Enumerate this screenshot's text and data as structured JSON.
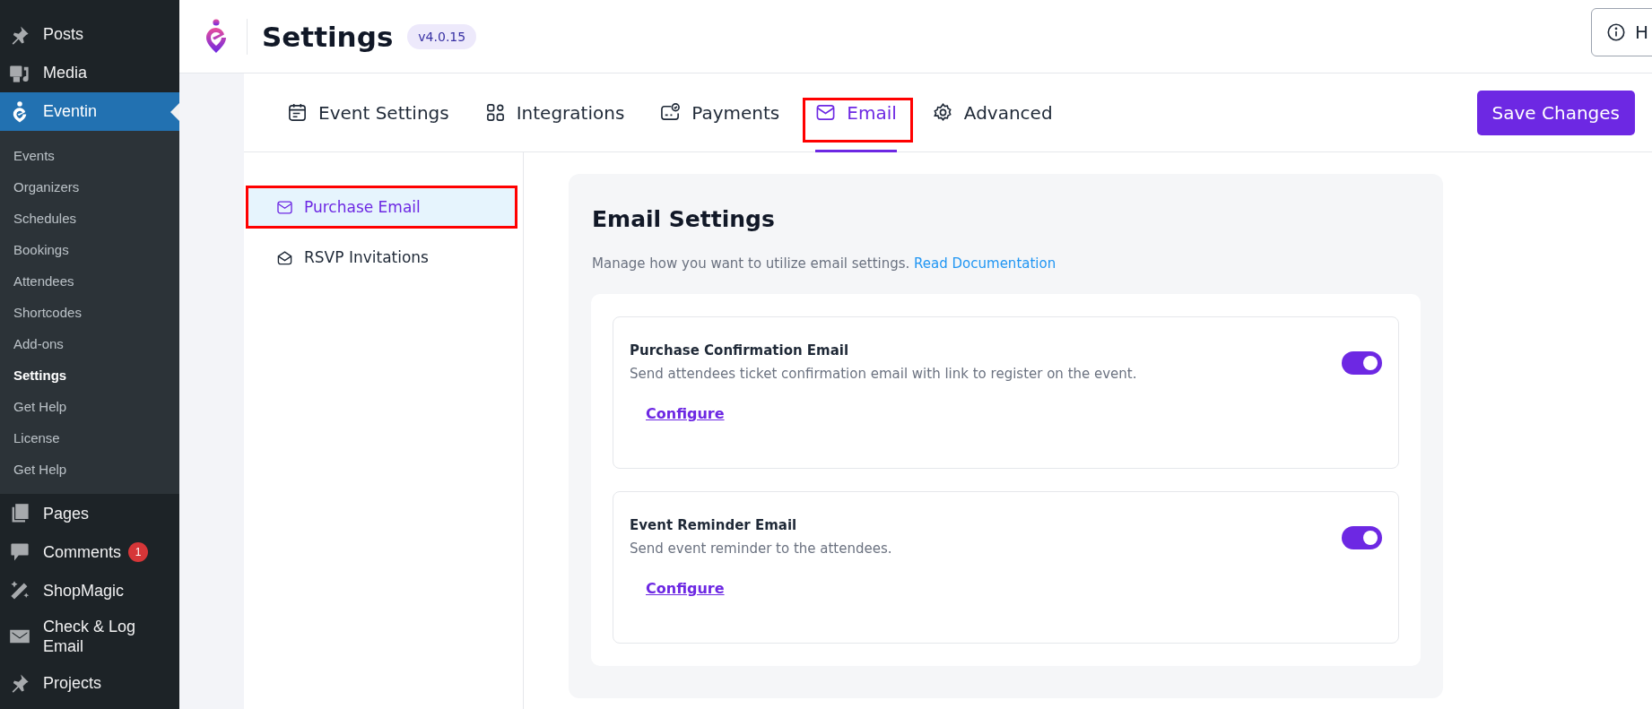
{
  "admin_menu": {
    "top": [
      {
        "label": "Posts",
        "kind": "pin",
        "current": false
      },
      {
        "label": "Media",
        "kind": "media",
        "current": false
      },
      {
        "label": "Eventin",
        "kind": "eventin",
        "current": true
      }
    ],
    "submenu": [
      {
        "label": "Events",
        "selected": false
      },
      {
        "label": "Organizers",
        "selected": false
      },
      {
        "label": "Schedules",
        "selected": false
      },
      {
        "label": "Bookings",
        "selected": false
      },
      {
        "label": "Attendees",
        "selected": false
      },
      {
        "label": "Shortcodes",
        "selected": false
      },
      {
        "label": "Add-ons",
        "selected": false
      },
      {
        "label": "Settings",
        "selected": true
      },
      {
        "label": "Get Help",
        "selected": false
      },
      {
        "label": "License",
        "selected": false
      },
      {
        "label": "Get Help",
        "selected": false
      }
    ],
    "bottom": [
      {
        "label": "Pages",
        "kind": "pages",
        "current": false
      },
      {
        "label": "Comments",
        "kind": "comment",
        "current": false,
        "badge": "1"
      },
      {
        "label": "ShopMagic",
        "kind": "wand",
        "current": false
      },
      {
        "label": "Check & Log Email",
        "kind": "mail",
        "current": false
      },
      {
        "label": "Projects",
        "kind": "pin",
        "current": false
      }
    ]
  },
  "header": {
    "title": "Settings",
    "version": "v4.0.15",
    "help_button": "H"
  },
  "tabs": [
    {
      "label": "Event Settings",
      "kind": "calendar",
      "selected": false,
      "highlighted": false
    },
    {
      "label": "Integrations",
      "kind": "grid",
      "selected": false,
      "highlighted": false
    },
    {
      "label": "Payments",
      "kind": "wallet",
      "selected": false,
      "highlighted": false
    },
    {
      "label": "Email",
      "kind": "mail",
      "selected": true,
      "highlighted": true
    },
    {
      "label": "Advanced",
      "kind": "gear",
      "selected": false,
      "highlighted": false
    }
  ],
  "save_button": "Save Changes",
  "side_nav": [
    {
      "label": "Purchase Email",
      "kind": "mail",
      "selected": true,
      "highlighted": true
    },
    {
      "label": "RSVP Invitations",
      "kind": "open-mail",
      "selected": false,
      "highlighted": false
    }
  ],
  "panel": {
    "title": "Email Settings",
    "description": "Manage how you want to utilize email settings.",
    "link": "Read Documentation",
    "items": [
      {
        "title": "Purchase Confirmation Email",
        "description": "Send attendees ticket confirmation email with link to register on the event.",
        "on": true,
        "action": "Configure"
      },
      {
        "title": "Event Reminder Email",
        "description": "Send event reminder to the attendees.",
        "on": true,
        "action": "Configure"
      }
    ]
  }
}
